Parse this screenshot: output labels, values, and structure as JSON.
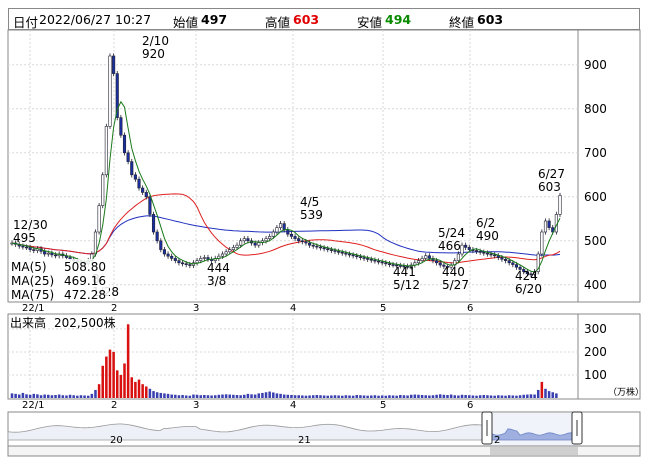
{
  "header": {
    "date_label": "日付",
    "datetime": "2022/06/27 10:27",
    "open_label": "始値",
    "open": "497",
    "high_label": "高値",
    "high": "603",
    "low_label": "安値",
    "low": "494",
    "close_label": "終値",
    "close": "603"
  },
  "colors": {
    "up_candle": "#ffffff",
    "down_candle": "#1a2fa0",
    "ma5": "#1a7a1a",
    "ma25": "#e02020",
    "ma75": "#2030c0",
    "volume": "#d81010",
    "volume_other": "#3a40b0",
    "thumbnail_range": "#6f86c8"
  },
  "legend": {
    "ma5_label": "MA(5)",
    "ma5_value": "508.80",
    "ma25_label": "MA(25)",
    "ma25_value": "469.16",
    "ma75_label": "MA(75)",
    "ma75_value": "472.28"
  },
  "volume_panel": {
    "title": "出来高",
    "value": "202,500株",
    "unit": "（万株）"
  },
  "chart_data": {
    "type": "candlestick",
    "y_ticks": [
      "900",
      "800",
      "700",
      "600",
      "500",
      "400"
    ],
    "ylim": [
      370,
      970
    ],
    "x_ticks": [
      "22/1",
      "2",
      "3",
      "4",
      "5",
      "6"
    ],
    "volume_ticks": [
      "300",
      "200",
      "100"
    ],
    "volume_ylim": [
      0,
      330
    ],
    "thumbnail_ticks": [
      "20",
      "21",
      "2"
    ],
    "annotations": [
      {
        "date": "12/30",
        "value": "495"
      },
      {
        "date": "1/28",
        "value": "8"
      },
      {
        "date": "2/10",
        "value": "920"
      },
      {
        "date": "3/8",
        "value": "444"
      },
      {
        "date": "4/5",
        "value": "539"
      },
      {
        "date": "5/12",
        "value": "441"
      },
      {
        "date": "5/24",
        "value": "466"
      },
      {
        "date": "5/27",
        "value": "440"
      },
      {
        "date": "6/2",
        "value": "490"
      },
      {
        "date": "6/20",
        "value": "424"
      },
      {
        "date": "6/27",
        "value": "603"
      }
    ],
    "close_series": [
      495,
      492,
      488,
      486,
      485,
      480,
      478,
      482,
      476,
      470,
      472,
      468,
      466,
      470,
      466,
      462,
      458,
      455,
      452,
      450,
      448,
      455,
      470,
      520,
      580,
      650,
      760,
      920,
      880,
      780,
      740,
      700,
      680,
      650,
      640,
      620,
      610,
      600,
      560,
      520,
      500,
      480,
      470,
      465,
      460,
      455,
      450,
      448,
      446,
      444,
      450,
      455,
      460,
      462,
      458,
      455,
      460,
      465,
      470,
      475,
      480,
      485,
      490,
      500,
      505,
      500,
      495,
      490,
      496,
      500,
      505,
      510,
      520,
      530,
      539,
      525,
      515,
      510,
      505,
      500,
      498,
      495,
      490,
      488,
      486,
      484,
      482,
      480,
      478,
      476,
      474,
      472,
      470,
      468,
      466,
      464,
      462,
      460,
      458,
      456,
      454,
      452,
      450,
      448,
      446,
      445,
      444,
      443,
      442,
      441,
      445,
      450,
      455,
      460,
      466,
      460,
      455,
      450,
      445,
      442,
      440,
      445,
      455,
      470,
      490,
      485,
      480,
      478,
      476,
      474,
      472,
      470,
      468,
      466,
      462,
      458,
      455,
      450,
      446,
      440,
      435,
      430,
      425,
      424,
      430,
      470,
      520,
      545,
      530,
      520,
      560,
      603
    ],
    "volume_series": [
      20,
      18,
      15,
      22,
      16,
      14,
      18,
      16,
      12,
      15,
      14,
      12,
      13,
      15,
      12,
      11,
      14,
      12,
      10,
      12,
      11,
      10,
      18,
      35,
      60,
      140,
      180,
      210,
      200,
      120,
      100,
      150,
      320,
      90,
      70,
      80,
      60,
      50,
      40,
      30,
      25,
      22,
      20,
      18,
      15,
      14,
      12,
      13,
      11,
      10,
      15,
      14,
      12,
      13,
      12,
      11,
      12,
      14,
      15,
      16,
      15,
      14,
      13,
      12,
      14,
      18,
      16,
      15,
      20,
      22,
      25,
      28,
      24,
      20,
      18,
      15,
      14,
      13,
      12,
      12,
      11,
      10,
      11,
      12,
      13,
      12,
      11,
      10,
      11,
      12,
      11,
      10,
      12,
      11,
      10,
      13,
      12,
      11,
      10,
      11,
      12,
      10,
      11,
      10,
      12,
      11,
      10,
      13,
      12,
      11,
      14,
      15,
      14,
      13,
      12,
      11,
      12,
      14,
      16,
      14,
      13,
      15,
      12,
      11,
      14,
      13,
      12,
      11,
      10,
      12,
      13,
      12,
      11,
      10,
      12,
      11,
      10,
      12,
      11,
      10,
      12,
      14,
      15,
      16,
      15,
      35,
      70,
      40,
      30,
      25,
      20
    ]
  }
}
